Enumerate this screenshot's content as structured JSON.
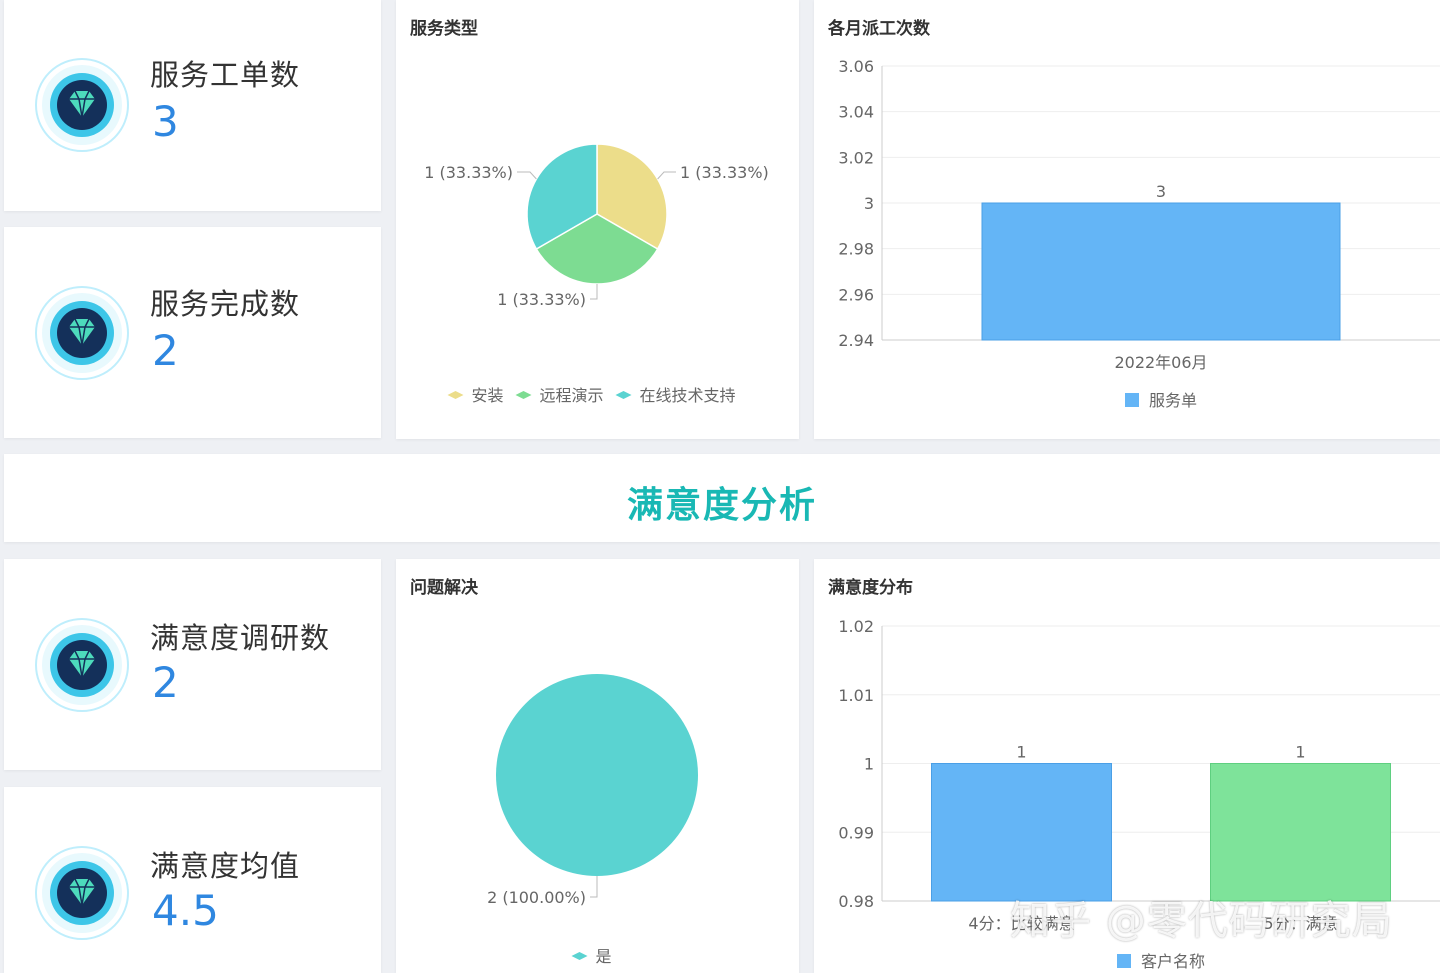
{
  "kpis": {
    "orders": {
      "title": "服务工单数",
      "value": "3"
    },
    "completed": {
      "title": "服务完成数",
      "value": "2"
    },
    "surveys": {
      "title": "满意度调研数",
      "value": "2"
    },
    "average": {
      "title": "满意度均值",
      "value": "4.5"
    }
  },
  "banner": {
    "title": "满意度分析"
  },
  "service_type": {
    "title": "服务类型"
  },
  "monthly": {
    "title": "各月派工次数"
  },
  "resolution": {
    "title": "问题解决"
  },
  "satisfaction": {
    "title": "满意度分布"
  },
  "watermark": {
    "text": "知乎 @零代码研究局"
  },
  "icons": {
    "kpi_icon": "diamond-icon"
  },
  "colors": {
    "accent": "#19b8b4",
    "kpi_value": "#2f87e0",
    "bar_blue": "#64b5f6",
    "bar_green": "#7ee39a"
  },
  "chart_data": [
    {
      "type": "pie",
      "title": "服务类型",
      "categories": [
        "安装",
        "远程演示",
        "在线技术支持"
      ],
      "values": [
        1,
        1,
        1
      ],
      "data_labels": [
        "1 (33.33%)",
        "1 (33.33%)",
        "1 (33.33%)"
      ],
      "colors": [
        "#ecdd8a",
        "#7ddc92",
        "#5ad3d1"
      ],
      "legend": "bottom"
    },
    {
      "type": "bar",
      "title": "各月派工次数",
      "categories": [
        "2022年06月"
      ],
      "series": [
        {
          "name": "服务单",
          "values": [
            3
          ]
        }
      ],
      "yticks": [
        "3.06",
        "3.04",
        "3.02",
        "3",
        "2.98",
        "2.96",
        "2.94"
      ],
      "ylim": [
        2.94,
        3.06
      ],
      "grid": true,
      "legend": "bottom",
      "color": "#64b5f6"
    },
    {
      "type": "pie",
      "title": "问题解决",
      "categories": [
        "是"
      ],
      "values": [
        2
      ],
      "data_labels": [
        "2 (100.00%)"
      ],
      "colors": [
        "#5ad3d1"
      ],
      "legend": "bottom"
    },
    {
      "type": "bar",
      "title": "满意度分布",
      "categories": [
        "4分：比较满意",
        "5分：满意"
      ],
      "series": [
        {
          "name": "客户名称",
          "values": [
            1,
            1
          ]
        }
      ],
      "yticks": [
        "1.02",
        "1.01",
        "1",
        "0.99",
        "0.98"
      ],
      "ylim": [
        0.98,
        1.02
      ],
      "grid": true,
      "legend": "bottom",
      "colors": [
        "#64b5f6",
        "#7ee39a"
      ]
    }
  ]
}
